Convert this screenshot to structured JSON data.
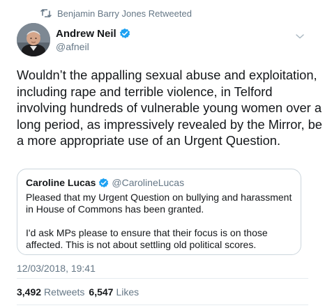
{
  "retweet_context": {
    "text": "Benjamin Barry Jones Retweeted",
    "icon": "retweet-icon"
  },
  "tweet": {
    "author_name": "Andrew Neil",
    "author_handle": "@afneil",
    "verified": true,
    "text": "Wouldn’t the appalling sexual abuse and exploitation, including rape and terrible violence, in Telford involving hundreds of vulnerable young women over a long period, as impressively revealed by the Mirror, be a more appropriate use of an Urgent Question.",
    "timestamp": "12/03/2018, 19:41"
  },
  "quoted_tweet": {
    "author_name": "Caroline Lucas",
    "author_handle": "@CarolineLucas",
    "verified": true,
    "paragraph_1": "Pleased that my Urgent Question on bullying and harassment in House of Commons has been granted.",
    "paragraph_2": "I'd ask MPs please to ensure that their focus is on those affected. This is not about settling old political scores."
  },
  "stats": {
    "retweets_count": "3,492",
    "retweets_label": "Retweets",
    "likes_count": "6,547",
    "likes_label": "Likes"
  },
  "colors": {
    "verified_blue": "#1da1f2",
    "secondary_text": "#657786",
    "primary_text": "#14171a",
    "border": "#ccd6dd"
  }
}
